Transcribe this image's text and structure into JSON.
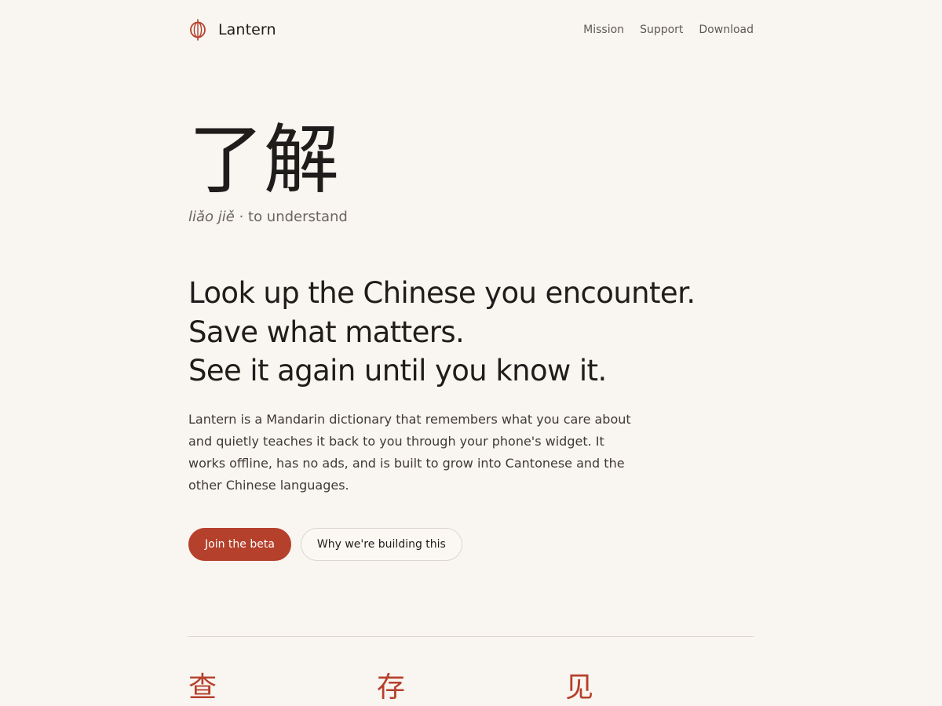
{
  "header": {
    "brand_name": "Lantern",
    "brand_icon": "lantern-icon",
    "nav": [
      {
        "label": "Mission"
      },
      {
        "label": "Support"
      },
      {
        "label": "Download"
      }
    ]
  },
  "hero": {
    "characters": "了解",
    "pinyin": "liǎo jiě",
    "separator": " · ",
    "meaning": "to understand"
  },
  "headline": {
    "lines": [
      "Look up the Chinese you encounter.",
      "Save what matters.",
      "See it again until you know it."
    ]
  },
  "body": {
    "text": "Lantern is a Mandarin dictionary that remembers what you care about and quietly teaches it back to you through your phone's widget. It works offline, has no ads, and is built to grow into Cantonese and the other Chinese languages."
  },
  "actions": {
    "primary_label": "Join the beta",
    "secondary_label": "Why we're building this"
  },
  "features": [
    {
      "char": "查"
    },
    {
      "char": "存"
    },
    {
      "char": "见"
    }
  ],
  "colors": {
    "accent": "#b5402c",
    "background": "#f9f5f0",
    "text": "#1f1d1b",
    "muted": "#6b655f"
  }
}
